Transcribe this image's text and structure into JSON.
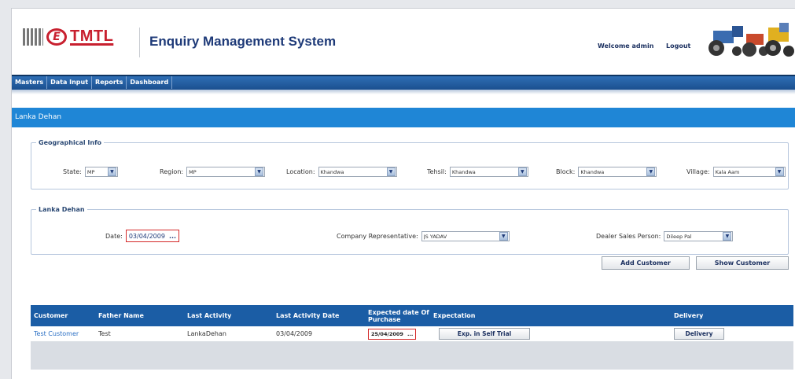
{
  "header": {
    "logo_text": "TMTL",
    "logo_letter": "E",
    "app_title": "Enquiry Management System",
    "welcome_text": "Welcome admin",
    "logout_label": "Logout"
  },
  "nav": {
    "items": [
      "Masters",
      "Data Input",
      "Reports",
      "Dashboard"
    ]
  },
  "page_title": "Lanka Dehan",
  "geo": {
    "legend": "Geographical Info",
    "state": {
      "label": "State:",
      "value": "MP"
    },
    "region": {
      "label": "Region:",
      "value": "MP"
    },
    "location": {
      "label": "Location:",
      "value": "Khandwa"
    },
    "tehsil": {
      "label": "Tehsil:",
      "value": "Khandwa"
    },
    "block": {
      "label": "Block:",
      "value": "Khandwa"
    },
    "village": {
      "label": "Village:",
      "value": "Kala Aam"
    }
  },
  "lanka": {
    "legend": "Lanka Dehan",
    "date": {
      "label": "Date:",
      "value": "03/04/2009",
      "picker": "..."
    },
    "company_rep": {
      "label": "Company Representative:",
      "value": "JS YADAV"
    },
    "dealer_sales": {
      "label": "Dealer Sales Person:",
      "value": "Dileep Pal"
    }
  },
  "buttons": {
    "add_customer": "Add Customer",
    "show_customer": "Show Customer"
  },
  "table": {
    "columns": [
      "Customer",
      "Father Name",
      "Last Activity",
      "Last Activity Date",
      "Expected date Of Purchase",
      "Expectation",
      "Delivery"
    ],
    "rows": [
      {
        "customer": "Test Customer",
        "father_name": "Test",
        "last_activity": "LankaDehan",
        "last_activity_date": "03/04/2009",
        "expected_date": "25/04/2009",
        "expected_picker": "...",
        "expectation_btn": "Exp. in Self Trial",
        "delivery_btn": "Delivery"
      }
    ]
  },
  "colors": {
    "brand_red": "#c8202f",
    "nav_blue": "#1b4f8f",
    "section_blue": "#1f86d6",
    "grid_header": "#1b5da5"
  }
}
